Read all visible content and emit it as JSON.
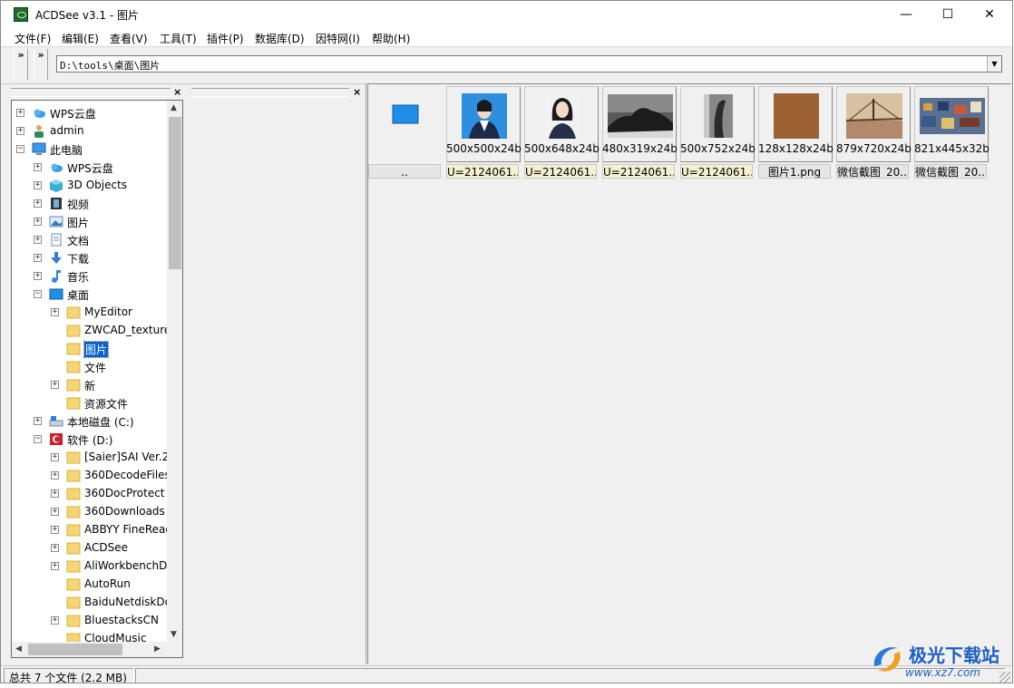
{
  "window": {
    "title": "ACDSee v3.1 - 图片",
    "minimize": "—",
    "maximize": "☐",
    "close": "✕"
  },
  "menu": [
    "文件(F)",
    "编辑(E)",
    "查看(V)",
    "工具(T)",
    "插件(P)",
    "数据库(D)",
    "因特网(I)",
    "帮助(H)"
  ],
  "toolbar": {
    "chevron": "»",
    "address": "D:\\tools\\桌面\\图片"
  },
  "tree": [
    {
      "label": "WPS云盘",
      "icon": "cloud-icon",
      "expander": "+"
    },
    {
      "label": "admin",
      "icon": "user-icon",
      "expander": "+"
    },
    {
      "label": "此电脑",
      "icon": "computer-icon",
      "expander": "−"
    },
    {
      "label": "WPS云盘",
      "icon": "cloud-icon",
      "expander": "+"
    },
    {
      "label": "3D Objects",
      "icon": "cube-icon",
      "expander": "+"
    },
    {
      "label": "视频",
      "icon": "video-icon",
      "expander": "+"
    },
    {
      "label": "图片",
      "icon": "picture-icon",
      "expander": "+"
    },
    {
      "label": "文档",
      "icon": "document-icon",
      "expander": "+"
    },
    {
      "label": "下载",
      "icon": "download-icon",
      "expander": "+"
    },
    {
      "label": "音乐",
      "icon": "music-icon",
      "expander": "+"
    },
    {
      "label": "桌面",
      "icon": "desktop-icon",
      "expander": "−"
    },
    {
      "label": "MyEditor",
      "icon": "folder-icon",
      "expander": "+"
    },
    {
      "label": "ZWCAD_texture",
      "icon": "folder-icon",
      "expander": ""
    },
    {
      "label": "图片",
      "icon": "folder-icon",
      "expander": "",
      "selected": true
    },
    {
      "label": "文件",
      "icon": "folder-icon",
      "expander": ""
    },
    {
      "label": "新",
      "icon": "folder-icon",
      "expander": "+"
    },
    {
      "label": "资源文件",
      "icon": "folder-icon",
      "expander": ""
    },
    {
      "label": "本地磁盘 (C:)",
      "icon": "drive-icon",
      "expander": "+"
    },
    {
      "label": "软件 (D:)",
      "icon": "drive-d-icon",
      "expander": "−"
    },
    {
      "label": "[Saier]SAI Ver.2",
      "icon": "folder-icon",
      "expander": "+"
    },
    {
      "label": "360DecodeFiles",
      "icon": "folder-icon",
      "expander": "+"
    },
    {
      "label": "360DocProtect",
      "icon": "folder-icon",
      "expander": "+"
    },
    {
      "label": "360Downloads",
      "icon": "folder-icon",
      "expander": "+"
    },
    {
      "label": "ABBYY FineReader",
      "icon": "folder-icon",
      "expander": "+"
    },
    {
      "label": "ACDSee",
      "icon": "folder-icon",
      "expander": "+"
    },
    {
      "label": "AliWorkbenchD",
      "icon": "folder-icon",
      "expander": "+"
    },
    {
      "label": "AutoRun",
      "icon": "folder-icon",
      "expander": ""
    },
    {
      "label": "BaiduNetdiskDo",
      "icon": "folder-icon",
      "expander": ""
    },
    {
      "label": "BluestacksCN",
      "icon": "folder-icon",
      "expander": "+"
    },
    {
      "label": "CloudMusic",
      "icon": "folder-icon",
      "expander": ""
    }
  ],
  "thumbnails": [
    {
      "info": "",
      "name": "..",
      "style": "g",
      "kind": "parent"
    },
    {
      "info": "500x500x24b",
      "name": "U=2124061...",
      "style": "u",
      "kind": "portrait-blue"
    },
    {
      "info": "500x648x24b",
      "name": "U=2124061...",
      "style": "u",
      "kind": "portrait-white"
    },
    {
      "info": "480x319x24b",
      "name": "U=2124061...",
      "style": "u",
      "kind": "rock-bw"
    },
    {
      "info": "500x752x24b",
      "name": "U=2124061...",
      "style": "u",
      "kind": "tree-bw"
    },
    {
      "info": "128x128x24b",
      "name": "图片1.png",
      "style": "g",
      "kind": "leather"
    },
    {
      "info": "879x720x24b",
      "name": "微信截图_20...",
      "style": "g",
      "kind": "bridge"
    },
    {
      "info": "821x445x32b",
      "name": "微信截图_20...",
      "style": "g",
      "kind": "city"
    }
  ],
  "status": {
    "summary": "总共 7 个文件 (2.2 MB)"
  },
  "watermark": {
    "title": "极光下载站",
    "url": "www.xz7.com"
  }
}
